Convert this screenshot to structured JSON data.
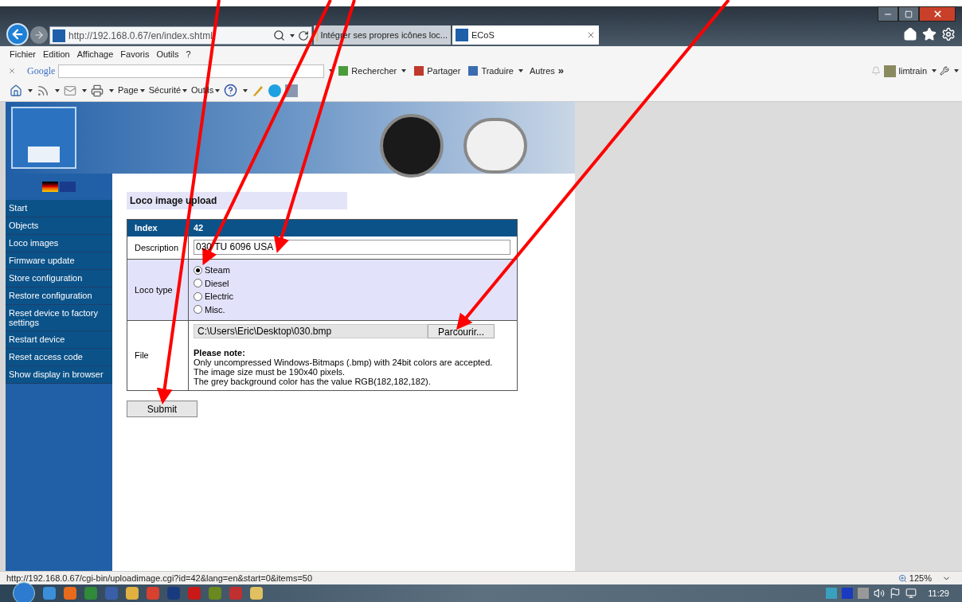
{
  "browser": {
    "address": "http://192.168.0.67/en/index.shtml",
    "tabs": [
      {
        "title": "Intégrer ses propres icônes loc...",
        "selected": false
      },
      {
        "title": "ECoS",
        "selected": true
      }
    ]
  },
  "menu": [
    "Fichier",
    "Edition",
    "Affichage",
    "Favoris",
    "Outils",
    "?"
  ],
  "google_toolbar": {
    "brand": "Google",
    "search_button": "Rechercher",
    "share": "Partager",
    "translate": "Traduire",
    "more": "Autres",
    "more_glyph": "»",
    "user": "limtrain"
  },
  "command_bar": [
    "Page",
    "Sécurité",
    "Outils"
  ],
  "sidebar": {
    "items": [
      "Start",
      "Objects",
      "Loco images",
      "Firmware update",
      "Store configuration",
      "Restore configuration",
      "Reset device to factory settings",
      "Restart device",
      "Reset access code",
      "Show display in browser"
    ]
  },
  "page": {
    "title": "Loco image upload",
    "table": {
      "header": {
        "label": "Index",
        "value": "42"
      },
      "description": {
        "label": "Description",
        "value": "030 TU 6096 USA"
      },
      "loco_type": {
        "label": "Loco type",
        "options": [
          {
            "label": "Steam",
            "selected": true
          },
          {
            "label": "Diesel",
            "selected": false
          },
          {
            "label": "Electric",
            "selected": false
          },
          {
            "label": "Misc.",
            "selected": false
          }
        ]
      },
      "file": {
        "label": "File",
        "value": "C:\\Users\\Eric\\Desktop\\030.bmp",
        "browse_button": "Parcourir...",
        "note_title": "Please note:",
        "note_lines": [
          "Only uncompressed Windows-Bitmaps (.bmp) with 24bit colors are accepted.",
          "The image size must be 190x40 pixels.",
          "The grey background color has the value RGB(182,182,182)."
        ]
      }
    },
    "submit": "Submit"
  },
  "status_bar": {
    "url": "http://192.168.0.67/cgi-bin/uploadimage.cgi?id=42&lang=en&start=0&items=50",
    "zoom": "125%"
  },
  "taskbar": {
    "clock": "11:29"
  },
  "annotations": [
    {
      "kind": "arrow"
    },
    {
      "kind": "arrow"
    },
    {
      "kind": "arrow"
    },
    {
      "kind": "arrow"
    }
  ]
}
